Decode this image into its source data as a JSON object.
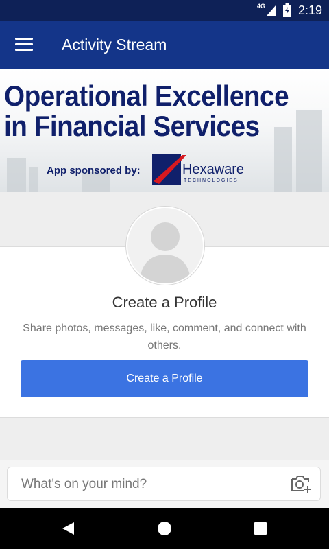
{
  "status": {
    "network": "4G",
    "time": "2:19"
  },
  "appbar": {
    "title": "Activity Stream",
    "menu_icon": "hamburger-menu-icon"
  },
  "banner": {
    "line1": "Operational Excellence",
    "line2": "in Financial Services",
    "sponsor_label": "App sponsored by:",
    "logo_name": "Hexaware",
    "logo_tagline": "TECHNOLOGIES"
  },
  "profile_card": {
    "title": "Create a Profile",
    "description": "Share photos, messages, like, comment, and connect with others.",
    "button_label": "Create a Profile"
  },
  "composer": {
    "placeholder": "What's on your mind?",
    "camera_icon": "add-photo-camera-icon"
  },
  "nav": {
    "back_icon": "back-icon",
    "home_icon": "home-icon",
    "recents_icon": "recents-icon"
  },
  "colors": {
    "status_bar": "#0e2157",
    "app_bar": "#143589",
    "primary_button": "#3b73e2",
    "banner_text": "#10206b",
    "logo_accent": "#d71920"
  }
}
